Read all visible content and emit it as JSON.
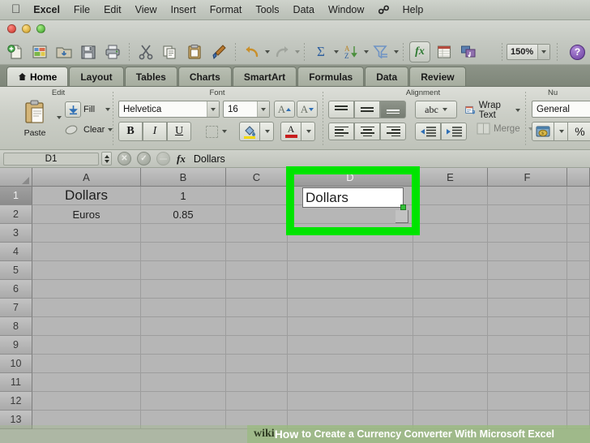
{
  "menubar": {
    "apple_icon": "apple-icon",
    "items": [
      {
        "label": "Excel",
        "bold": true
      },
      {
        "label": "File",
        "bold": false
      },
      {
        "label": "Edit",
        "bold": false
      },
      {
        "label": "View",
        "bold": false
      },
      {
        "label": "Insert",
        "bold": false
      },
      {
        "label": "Format",
        "bold": false
      },
      {
        "label": "Tools",
        "bold": false
      },
      {
        "label": "Data",
        "bold": false
      },
      {
        "label": "Window",
        "bold": false
      }
    ],
    "bluetooth_icon": "bluetooth-icon",
    "help_label": "Help"
  },
  "window_controls": {
    "close": "close-button",
    "minimize": "minimize-button",
    "zoom": "zoom-button"
  },
  "toolbar": {
    "icons": [
      "new-document-icon",
      "open-template-icon",
      "open-folder-icon",
      "save-icon",
      "print-icon",
      "cut-icon",
      "copy-icon",
      "paste-icon",
      "format-painter-icon",
      "undo-icon",
      "redo-icon",
      "autosum-icon",
      "sort-az-icon",
      "filter-icon",
      "formula-builder-icon",
      "sheet-view-icon",
      "media-browser-icon"
    ],
    "zoom_value": "150%",
    "help_label": "?"
  },
  "ribbon": {
    "tabs": [
      {
        "label": "Home",
        "icon": "home-icon",
        "active": true
      },
      {
        "label": "Layout",
        "active": false
      },
      {
        "label": "Tables",
        "active": false
      },
      {
        "label": "Charts",
        "active": false
      },
      {
        "label": "SmartArt",
        "active": false
      },
      {
        "label": "Formulas",
        "active": false
      },
      {
        "label": "Data",
        "active": false
      },
      {
        "label": "Review",
        "active": false
      }
    ],
    "groups": {
      "edit": {
        "title": "Edit",
        "paste_label": "Paste",
        "fill_label": "Fill",
        "clear_label": "Clear"
      },
      "font": {
        "title": "Font",
        "font_name": "Helvetica",
        "font_size": "16",
        "grow_label": "A",
        "shrink_label": "A",
        "bold_label": "B",
        "italic_label": "I",
        "underline_label": "U",
        "borders_icon": "borders-icon",
        "fill_color_icon": "fill-color-icon",
        "font_color_label": "A"
      },
      "alignment": {
        "title": "Alignment",
        "orientation_label": "abc",
        "wrap_text_label": "Wrap Text",
        "merge_label": "Merge"
      },
      "number": {
        "title": "Nu",
        "format_value": "General",
        "currency_icon": "currency-icon",
        "percent_label": "%"
      }
    }
  },
  "formula_bar": {
    "name_box": "D1",
    "cancel_icon": "cancel-icon",
    "accept_icon": "accept-icon",
    "formula_builder_icon": "fx-icon",
    "fx_label": "fx",
    "formula_value": "Dollars"
  },
  "sheet": {
    "columns": [
      "A",
      "B",
      "C",
      "D",
      "E",
      "F"
    ],
    "selected_column": "D",
    "rows": [
      "1",
      "2",
      "3",
      "4",
      "5",
      "6",
      "7",
      "8",
      "9",
      "10",
      "11",
      "12",
      "13"
    ],
    "selected_row": "1",
    "cells": [
      {
        "ref": "A1",
        "col": 0,
        "row": 0,
        "value": "Dollars",
        "big": true
      },
      {
        "ref": "B1",
        "col": 1,
        "row": 0,
        "value": "1",
        "big": false
      },
      {
        "ref": "A2",
        "col": 0,
        "row": 1,
        "value": "Euros",
        "big": false
      },
      {
        "ref": "B2",
        "col": 1,
        "row": 1,
        "value": "0.85",
        "big": false
      }
    ],
    "active_cell": {
      "ref": "D1",
      "value": "Dollars"
    }
  },
  "annotation": {
    "highlight_color": "#00e400",
    "target_cell": "D1"
  },
  "watermark": {
    "wiki": "wiki",
    "how": "How",
    "text": "to Create a Currency Converter With Microsoft Excel"
  }
}
